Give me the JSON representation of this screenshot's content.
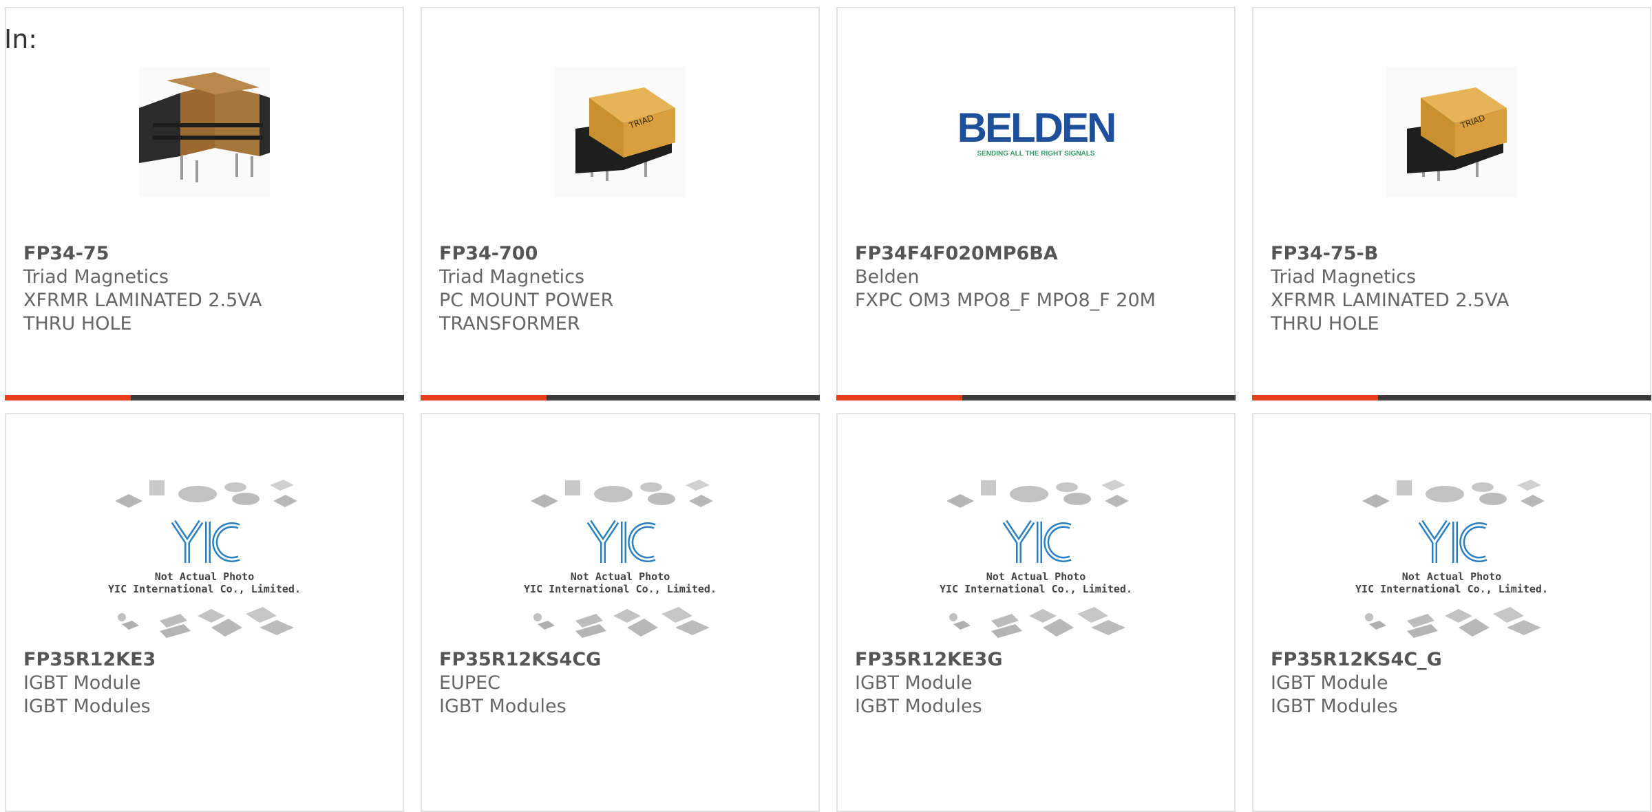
{
  "header": {
    "label": "In:"
  },
  "accent_color": "#e8401c",
  "bar_color": "#3c3c3c",
  "products": [
    {
      "part_number": "FP34-75",
      "manufacturer": "Triad Magnetics",
      "description": "XFRMR LAMINATED 2.5VA THRU HOLE",
      "image": "transformer-dark-photo"
    },
    {
      "part_number": "FP34-700",
      "manufacturer": "Triad Magnetics",
      "description": "PC MOUNT POWER TRANSFORMER",
      "image": "transformer-photo"
    },
    {
      "part_number": "FP34F4F020MP6BA",
      "manufacturer": "Belden",
      "description": "FXPC OM3 MPO8_F MPO8_F 20M",
      "image": "belden-logo",
      "logo_text": "BELDEN",
      "logo_tagline": "SENDING ALL THE RIGHT SIGNALS"
    },
    {
      "part_number": "FP34-75-B",
      "manufacturer": "Triad Magnetics",
      "description": "XFRMR LAMINATED 2.5VA THRU HOLE",
      "image": "transformer-photo"
    },
    {
      "part_number": "FP35R12KE3",
      "manufacturer": "IGBT Module",
      "description": "IGBT Modules",
      "image": "yic-placeholder",
      "placeholder_line1": "Not Actual Photo",
      "placeholder_line2": "YIC International Co., Limited."
    },
    {
      "part_number": "FP35R12KS4CG",
      "manufacturer": "EUPEC",
      "description": "IGBT Modules",
      "image": "yic-placeholder",
      "placeholder_line1": "Not Actual Photo",
      "placeholder_line2": "YIC International Co., Limited."
    },
    {
      "part_number": "FP35R12KE3G",
      "manufacturer": "IGBT Module",
      "description": "IGBT Modules",
      "image": "yic-placeholder",
      "placeholder_line1": "Not Actual Photo",
      "placeholder_line2": "YIC International Co., Limited."
    },
    {
      "part_number": "FP35R12KS4C_G",
      "manufacturer": "IGBT Module",
      "description": "IGBT Modules",
      "image": "yic-placeholder",
      "placeholder_line1": "Not Actual Photo",
      "placeholder_line2": "YIC International Co., Limited."
    }
  ]
}
